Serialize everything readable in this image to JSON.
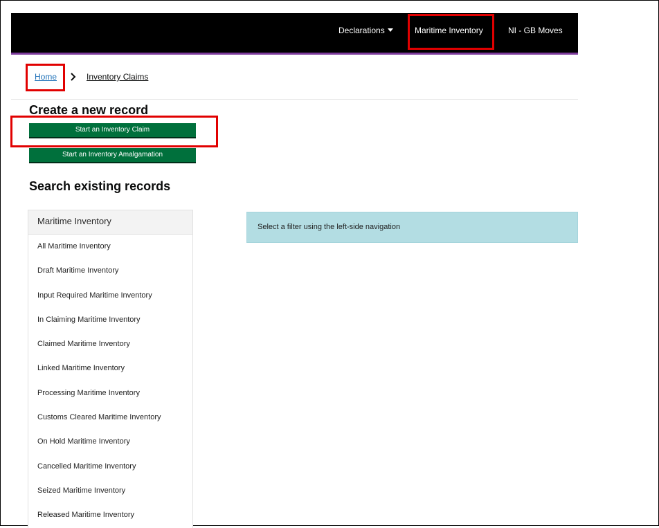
{
  "nav": {
    "declarations": "Declarations",
    "maritime_inventory": "Maritime Inventory",
    "ni_gb_moves": "NI - GB Moves"
  },
  "breadcrumb": {
    "home": "Home",
    "current": "Inventory Claims"
  },
  "create": {
    "heading": "Create a new record",
    "start_claim": "Start an Inventory Claim",
    "start_amalgamation": "Start an Inventory Amalgamation"
  },
  "search": {
    "heading": "Search existing records"
  },
  "sidebar": {
    "title": "Maritime Inventory",
    "items": [
      {
        "label": "All Maritime Inventory"
      },
      {
        "label": "Draft Maritime Inventory"
      },
      {
        "label": "Input Required Maritime Inventory"
      },
      {
        "label": "In Claiming Maritime Inventory"
      },
      {
        "label": "Claimed Maritime Inventory"
      },
      {
        "label": "Linked Maritime Inventory"
      },
      {
        "label": "Processing Maritime Inventory"
      },
      {
        "label": "Customs Cleared Maritime Inventory"
      },
      {
        "label": "On Hold Maritime Inventory"
      },
      {
        "label": "Cancelled Maritime Inventory"
      },
      {
        "label": "Seized Maritime Inventory"
      },
      {
        "label": "Released Maritime Inventory"
      }
    ]
  },
  "info": {
    "message": "Select a filter using the left-side navigation"
  },
  "colors": {
    "header_bg": "#000000",
    "header_accent": "#7d3b9c",
    "button_green": "#00703c",
    "info_bg": "#b3dde3",
    "link_blue": "#1d70b8",
    "highlight_red": "#e10000"
  },
  "icons": {
    "dropdown": "caret-down-icon",
    "breadcrumb_separator": "chevron-right-icon"
  }
}
